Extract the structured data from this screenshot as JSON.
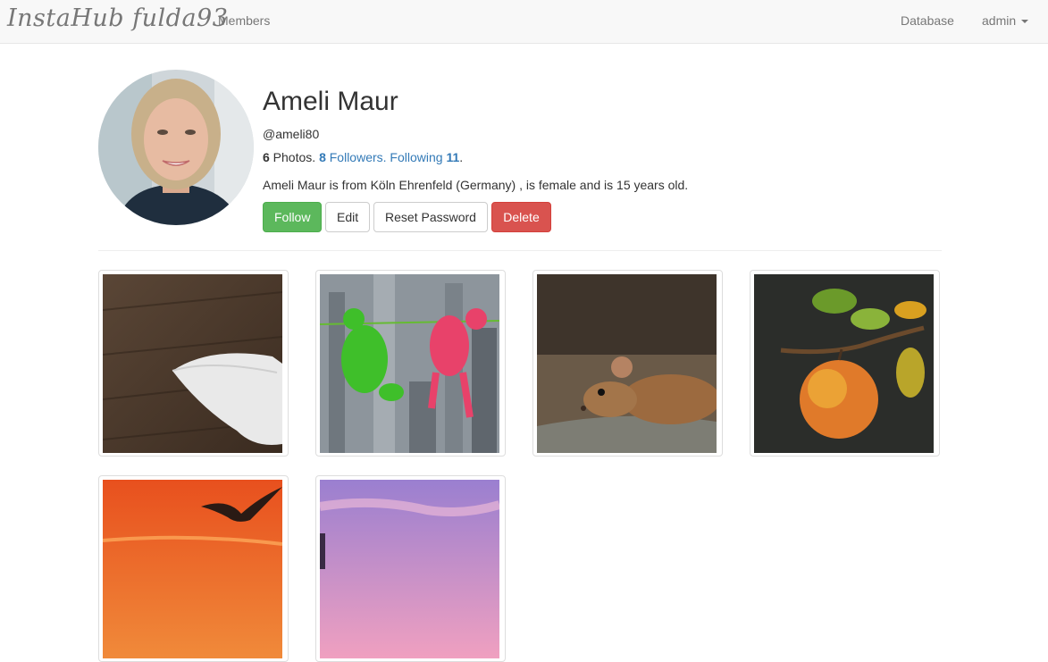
{
  "navbar": {
    "brand": "InstaHub fulda93",
    "members": "Members",
    "database": "Database",
    "user": "admin"
  },
  "profile": {
    "name": "Ameli Maur",
    "username": "@ameli80",
    "photos_count": "6",
    "photos_label": " Photos. ",
    "followers_count": "8",
    "followers_label": " Followers.",
    "following_label": " Following ",
    "following_count": "11",
    "following_end": ".",
    "bio": "Ameli Maur is from Köln Ehrenfeld (Germany) , is female and is 15 years old."
  },
  "actions": {
    "follow": "Follow",
    "edit": "Edit",
    "reset_password": "Reset Password",
    "delete": "Delete"
  },
  "colors": {
    "success": "#5cb85c",
    "danger": "#d9534f",
    "link": "#337ab7"
  },
  "photos": [
    {
      "subject": "computer-mouse-photo"
    },
    {
      "subject": "toy-frogs-city-photo"
    },
    {
      "subject": "mouse-animal-photo"
    },
    {
      "subject": "apple-tree-photo"
    },
    {
      "subject": "seagull-sunset-photo"
    },
    {
      "subject": "pink-sky-photo"
    }
  ]
}
